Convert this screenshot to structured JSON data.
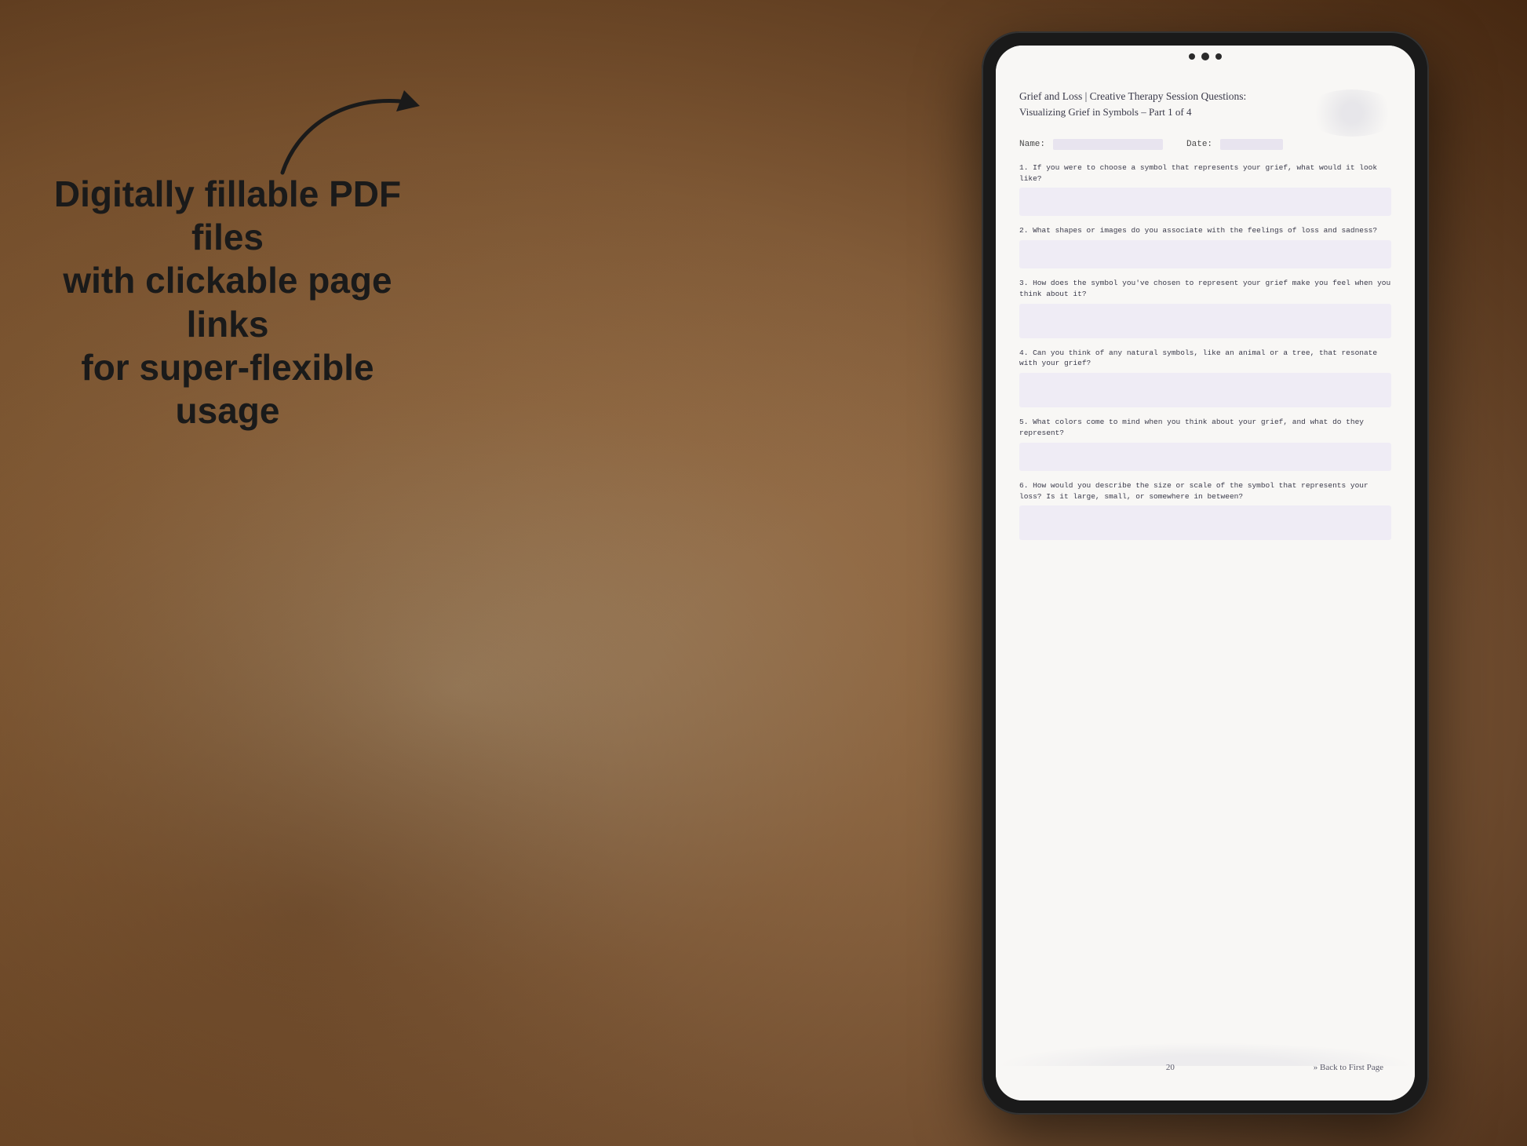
{
  "background": {
    "color": "#b8977e"
  },
  "left_panel": {
    "main_copy": "Digitally fillable PDF files\nwith clickable page links\nfor super-flexible usage"
  },
  "arrow": {
    "description": "curved arrow pointing right toward tablet"
  },
  "tablet": {
    "camera_dots": 3,
    "pdf": {
      "title_main": "Grief and Loss | Creative Therapy Session Questions:",
      "title_sub": "Visualizing Grief in Symbols  – Part 1 of 4",
      "name_label": "Name:",
      "date_label": "Date:",
      "questions": [
        {
          "number": "1.",
          "text": "If you were to choose a symbol that represents your grief, what would it look like?"
        },
        {
          "number": "2.",
          "text": "What shapes or images do you associate with the feelings of loss and sadness?"
        },
        {
          "number": "3.",
          "text": "How does the symbol you've chosen to represent your grief make you feel when you think about it?"
        },
        {
          "number": "4.",
          "text": "Can you think of any natural symbols, like an animal or a tree, that resonate with your grief?"
        },
        {
          "number": "5.",
          "text": "What colors come to mind when you think about your grief, and what do they represent?"
        },
        {
          "number": "6.",
          "text": "How would you describe the size or scale of the symbol that represents your loss? Is it large, small, or somewhere in between?"
        }
      ],
      "footer": {
        "page_number": "20",
        "back_link": "» Back to First Page"
      }
    }
  }
}
